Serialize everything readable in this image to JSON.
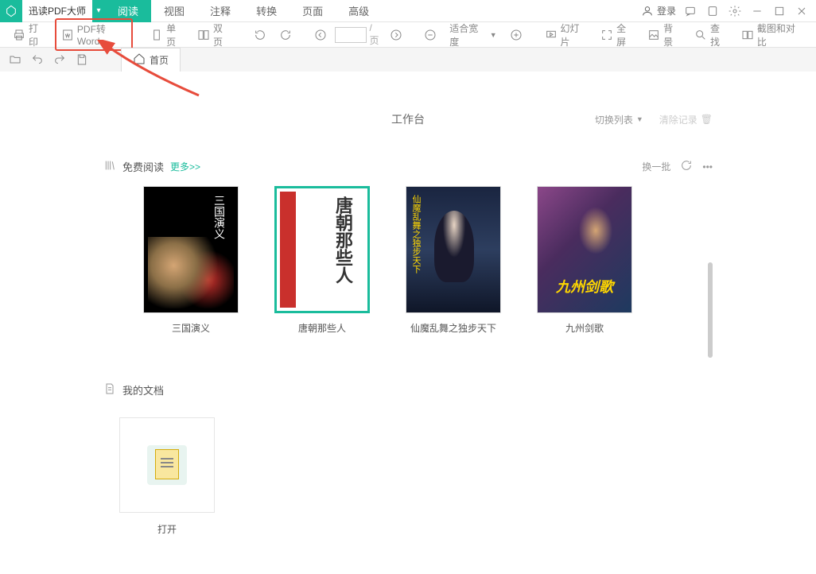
{
  "app": {
    "name": "迅读PDF大师",
    "login": "登录"
  },
  "menu": {
    "items": [
      "阅读",
      "视图",
      "注释",
      "转换",
      "页面",
      "高级"
    ],
    "active": 0
  },
  "toolbar": {
    "print": "打印",
    "pdf2word": "PDF转Word",
    "single_page": "单页",
    "double_page": "双页",
    "page_sep": "/页",
    "fit_width": "适合宽度",
    "slideshow": "幻灯片",
    "fullscreen": "全屏",
    "background": "背景",
    "find": "查找",
    "screenshot": "截图和对比"
  },
  "nav": {
    "home_tab": "首页"
  },
  "workbench": {
    "title": "工作台",
    "switch_list": "切换列表",
    "clear_history": "清除记录"
  },
  "free_read": {
    "title": "免费阅读",
    "more": "更多>>",
    "refresh": "换一批",
    "books": [
      {
        "title": "三国演义",
        "cover_text": "三国演义"
      },
      {
        "title": "唐朝那些人",
        "cover_text": "唐朝那些人"
      },
      {
        "title": "仙魔乱舞之独步天下",
        "cover_text": "仙魔乱舞之独步天下"
      },
      {
        "title": "九州剑歌",
        "cover_text": "九州剑歌"
      }
    ]
  },
  "mydocs": {
    "title": "我的文档",
    "open": "打开"
  }
}
